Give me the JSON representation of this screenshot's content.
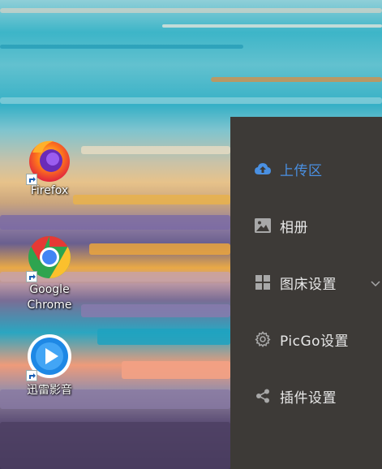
{
  "desktop": {
    "icons": [
      {
        "label": "Firefox",
        "icon": "firefox-icon"
      },
      {
        "label": "Google Chrome",
        "icon": "chrome-icon"
      },
      {
        "label": "迅雷影音",
        "icon": "xunlei-player-icon"
      }
    ]
  },
  "sidebar": {
    "items": [
      {
        "label": "上传区",
        "icon": "cloud-upload-icon",
        "active": true
      },
      {
        "label": "相册",
        "icon": "image-icon",
        "active": false
      },
      {
        "label": "图床设置",
        "icon": "grid-icon",
        "active": false,
        "expandable": true
      },
      {
        "label": "PicGo设置",
        "icon": "gear-icon",
        "active": false
      },
      {
        "label": "插件设置",
        "icon": "share-icon",
        "active": false
      }
    ]
  },
  "colors": {
    "panel_bg": "#3d3a37",
    "active": "#4a90e2",
    "text": "#e8e8e8",
    "icon": "#a8a8a8"
  }
}
